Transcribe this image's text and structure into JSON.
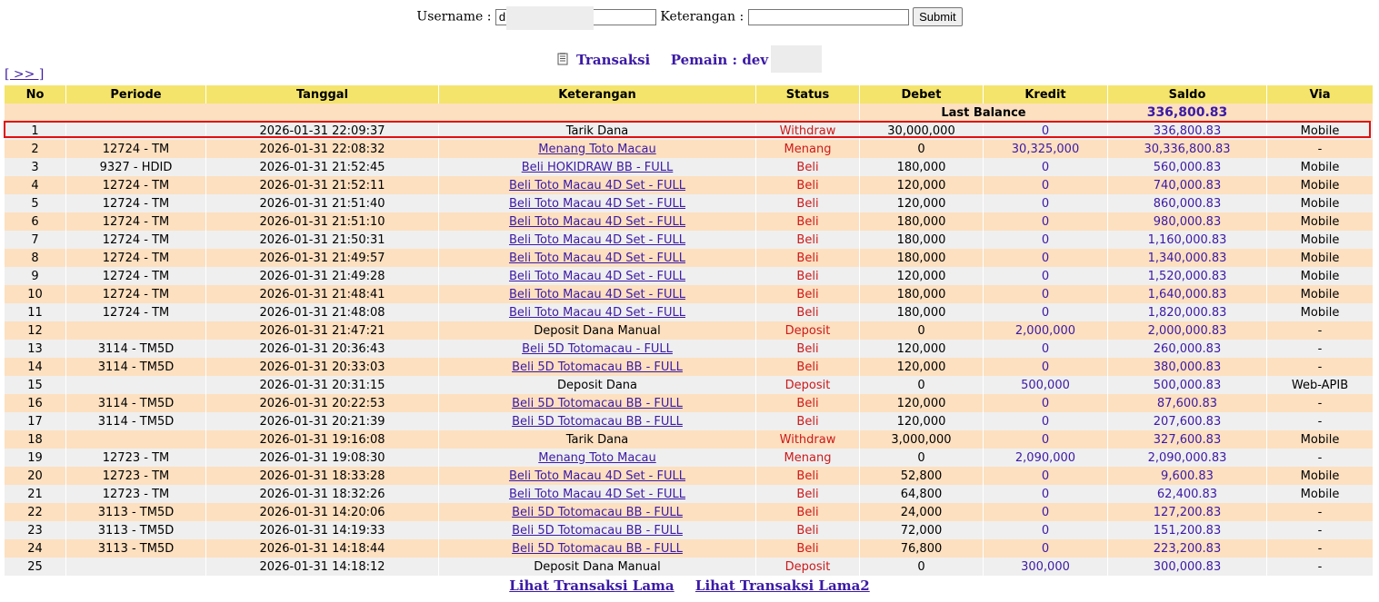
{
  "form": {
    "username_label": "Username :",
    "username_value": "d",
    "keterangan_label": "Keterangan :",
    "keterangan_value": "",
    "submit_label": "Submit"
  },
  "heading": {
    "title": "Transaksi",
    "pemain_label": "Pemain : dev"
  },
  "nav": {
    "next_label": "[ >> ]"
  },
  "table": {
    "headers": [
      "No",
      "Periode",
      "Tanggal",
      "Keterangan",
      "Status",
      "Debet",
      "Kredit",
      "Saldo",
      "Via"
    ],
    "last_balance_label": "Last Balance",
    "last_balance_value": "336,800.83",
    "rows": [
      {
        "no": "1",
        "periode": "",
        "tanggal": "2026-01-31 22:09:37",
        "keterangan": "Tarik Dana",
        "link": false,
        "status": "Withdraw",
        "debet": "30,000,000",
        "kredit": "0",
        "saldo": "336,800.83",
        "via": "Mobile"
      },
      {
        "no": "2",
        "periode": "12724 - TM",
        "tanggal": "2026-01-31 22:08:32",
        "keterangan": "Menang Toto Macau",
        "link": true,
        "status": "Menang",
        "debet": "0",
        "kredit": "30,325,000",
        "saldo": "30,336,800.83",
        "via": "-"
      },
      {
        "no": "3",
        "periode": "9327 - HDID",
        "tanggal": "2026-01-31 21:52:45",
        "keterangan": "Beli HOKIDRAW BB - FULL",
        "link": true,
        "status": "Beli",
        "debet": "180,000",
        "kredit": "0",
        "saldo": "560,000.83",
        "via": "Mobile"
      },
      {
        "no": "4",
        "periode": "12724 - TM",
        "tanggal": "2026-01-31 21:52:11",
        "keterangan": "Beli Toto Macau 4D Set - FULL",
        "link": true,
        "status": "Beli",
        "debet": "120,000",
        "kredit": "0",
        "saldo": "740,000.83",
        "via": "Mobile"
      },
      {
        "no": "5",
        "periode": "12724 - TM",
        "tanggal": "2026-01-31 21:51:40",
        "keterangan": "Beli Toto Macau 4D Set - FULL",
        "link": true,
        "status": "Beli",
        "debet": "120,000",
        "kredit": "0",
        "saldo": "860,000.83",
        "via": "Mobile"
      },
      {
        "no": "6",
        "periode": "12724 - TM",
        "tanggal": "2026-01-31 21:51:10",
        "keterangan": "Beli Toto Macau 4D Set - FULL",
        "link": true,
        "status": "Beli",
        "debet": "180,000",
        "kredit": "0",
        "saldo": "980,000.83",
        "via": "Mobile"
      },
      {
        "no": "7",
        "periode": "12724 - TM",
        "tanggal": "2026-01-31 21:50:31",
        "keterangan": "Beli Toto Macau 4D Set - FULL",
        "link": true,
        "status": "Beli",
        "debet": "180,000",
        "kredit": "0",
        "saldo": "1,160,000.83",
        "via": "Mobile"
      },
      {
        "no": "8",
        "periode": "12724 - TM",
        "tanggal": "2026-01-31 21:49:57",
        "keterangan": "Beli Toto Macau 4D Set - FULL",
        "link": true,
        "status": "Beli",
        "debet": "180,000",
        "kredit": "0",
        "saldo": "1,340,000.83",
        "via": "Mobile"
      },
      {
        "no": "9",
        "periode": "12724 - TM",
        "tanggal": "2026-01-31 21:49:28",
        "keterangan": "Beli Toto Macau 4D Set - FULL",
        "link": true,
        "status": "Beli",
        "debet": "120,000",
        "kredit": "0",
        "saldo": "1,520,000.83",
        "via": "Mobile"
      },
      {
        "no": "10",
        "periode": "12724 - TM",
        "tanggal": "2026-01-31 21:48:41",
        "keterangan": "Beli Toto Macau 4D Set - FULL",
        "link": true,
        "status": "Beli",
        "debet": "180,000",
        "kredit": "0",
        "saldo": "1,640,000.83",
        "via": "Mobile"
      },
      {
        "no": "11",
        "periode": "12724 - TM",
        "tanggal": "2026-01-31 21:48:08",
        "keterangan": "Beli Toto Macau 4D Set - FULL",
        "link": true,
        "status": "Beli",
        "debet": "180,000",
        "kredit": "0",
        "saldo": "1,820,000.83",
        "via": "Mobile"
      },
      {
        "no": "12",
        "periode": "",
        "tanggal": "2026-01-31 21:47:21",
        "keterangan": "Deposit Dana Manual",
        "link": false,
        "status": "Deposit",
        "debet": "0",
        "kredit": "2,000,000",
        "saldo": "2,000,000.83",
        "via": "-"
      },
      {
        "no": "13",
        "periode": "3114 - TM5D",
        "tanggal": "2026-01-31 20:36:43",
        "keterangan": "Beli 5D Totomacau - FULL",
        "link": true,
        "status": "Beli",
        "debet": "120,000",
        "kredit": "0",
        "saldo": "260,000.83",
        "via": "-"
      },
      {
        "no": "14",
        "periode": "3114 - TM5D",
        "tanggal": "2026-01-31 20:33:03",
        "keterangan": "Beli 5D Totomacau BB - FULL",
        "link": true,
        "status": "Beli",
        "debet": "120,000",
        "kredit": "0",
        "saldo": "380,000.83",
        "via": "-"
      },
      {
        "no": "15",
        "periode": "",
        "tanggal": "2026-01-31 20:31:15",
        "keterangan": "Deposit Dana",
        "link": false,
        "status": "Deposit",
        "debet": "0",
        "kredit": "500,000",
        "saldo": "500,000.83",
        "via": "Web-APIB"
      },
      {
        "no": "16",
        "periode": "3114 - TM5D",
        "tanggal": "2026-01-31 20:22:53",
        "keterangan": "Beli 5D Totomacau BB - FULL",
        "link": true,
        "status": "Beli",
        "debet": "120,000",
        "kredit": "0",
        "saldo": "87,600.83",
        "via": "-"
      },
      {
        "no": "17",
        "periode": "3114 - TM5D",
        "tanggal": "2026-01-31 20:21:39",
        "keterangan": "Beli 5D Totomacau BB - FULL",
        "link": true,
        "status": "Beli",
        "debet": "120,000",
        "kredit": "0",
        "saldo": "207,600.83",
        "via": "-"
      },
      {
        "no": "18",
        "periode": "",
        "tanggal": "2026-01-31 19:16:08",
        "keterangan": "Tarik Dana",
        "link": false,
        "status": "Withdraw",
        "debet": "3,000,000",
        "kredit": "0",
        "saldo": "327,600.83",
        "via": "Mobile"
      },
      {
        "no": "19",
        "periode": "12723 - TM",
        "tanggal": "2026-01-31 19:08:30",
        "keterangan": "Menang Toto Macau",
        "link": true,
        "status": "Menang",
        "debet": "0",
        "kredit": "2,090,000",
        "saldo": "2,090,000.83",
        "via": "-"
      },
      {
        "no": "20",
        "periode": "12723 - TM",
        "tanggal": "2026-01-31 18:33:28",
        "keterangan": "Beli Toto Macau 4D Set - FULL",
        "link": true,
        "status": "Beli",
        "debet": "52,800",
        "kredit": "0",
        "saldo": "9,600.83",
        "via": "Mobile"
      },
      {
        "no": "21",
        "periode": "12723 - TM",
        "tanggal": "2026-01-31 18:32:26",
        "keterangan": "Beli Toto Macau 4D Set - FULL",
        "link": true,
        "status": "Beli",
        "debet": "64,800",
        "kredit": "0",
        "saldo": "62,400.83",
        "via": "Mobile"
      },
      {
        "no": "22",
        "periode": "3113 - TM5D",
        "tanggal": "2026-01-31 14:20:06",
        "keterangan": "Beli 5D Totomacau BB - FULL",
        "link": true,
        "status": "Beli",
        "debet": "24,000",
        "kredit": "0",
        "saldo": "127,200.83",
        "via": "-"
      },
      {
        "no": "23",
        "periode": "3113 - TM5D",
        "tanggal": "2026-01-31 14:19:33",
        "keterangan": "Beli 5D Totomacau BB - FULL",
        "link": true,
        "status": "Beli",
        "debet": "72,000",
        "kredit": "0",
        "saldo": "151,200.83",
        "via": "-"
      },
      {
        "no": "24",
        "periode": "3113 - TM5D",
        "tanggal": "2026-01-31 14:18:44",
        "keterangan": "Beli 5D Totomacau BB - FULL",
        "link": true,
        "status": "Beli",
        "debet": "76,800",
        "kredit": "0",
        "saldo": "223,200.83",
        "via": "-"
      },
      {
        "no": "25",
        "periode": "",
        "tanggal": "2026-01-31 14:18:12",
        "keterangan": "Deposit Dana Manual",
        "link": false,
        "status": "Deposit",
        "debet": "0",
        "kredit": "300,000",
        "saldo": "300,000.83",
        "via": "-"
      }
    ]
  },
  "footer": {
    "link1": "Lihat Transaksi Lama",
    "link2": "Lihat Transaksi Lama2"
  },
  "colors": {
    "header_bg": "#f4e46c",
    "row_odd": "#efefef",
    "row_even": "#fde0c0",
    "link": "#3b1aa5",
    "status": "#cc1a1a",
    "highlight": "#e01010"
  }
}
